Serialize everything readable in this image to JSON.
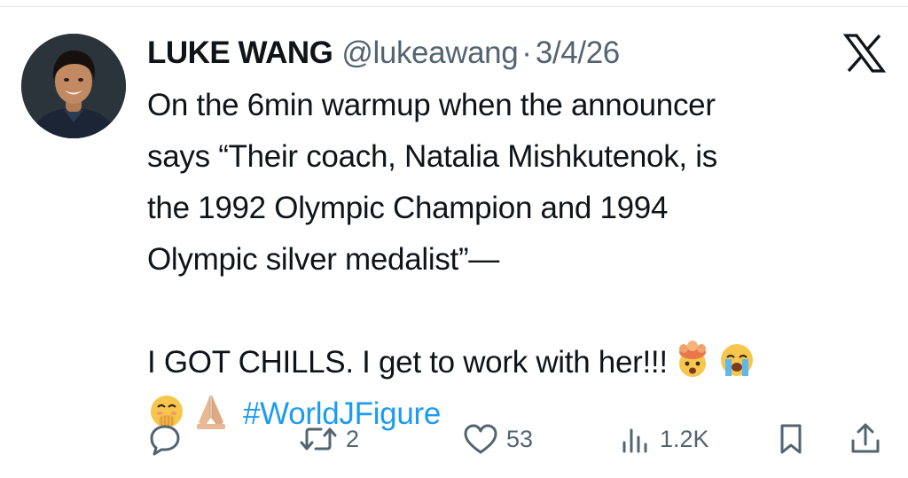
{
  "tweet": {
    "display_name": "LUKE WANG",
    "handle": "@lukeawang",
    "separator": "·",
    "date": "3/4/26",
    "body_lines": [
      "On the 6min warmup when the announcer",
      "says “Their coach, Natalia Mishkutenok, is",
      "the 1992 Olympic Champion and 1994",
      "Olympic silver medalist”—",
      "I GOT CHILLS. I get to work with her!!!"
    ],
    "hashtag": "#WorldJFigure",
    "emojis": [
      "exploding-head-emoji",
      "loudly-crying-face-emoji",
      "face-with-hand-over-mouth-emoji",
      "folded-hands-emoji"
    ]
  },
  "actions": {
    "replies_count": "",
    "reposts_count": "2",
    "likes_count": "53",
    "views_count": "1.2K"
  },
  "colors": {
    "text": "#0f1419",
    "secondary": "#536471",
    "link": "#1d9bf0"
  },
  "icons": [
    "x-logo-icon",
    "reply-icon",
    "repost-icon",
    "like-icon",
    "views-icon",
    "bookmark-icon",
    "share-icon"
  ]
}
